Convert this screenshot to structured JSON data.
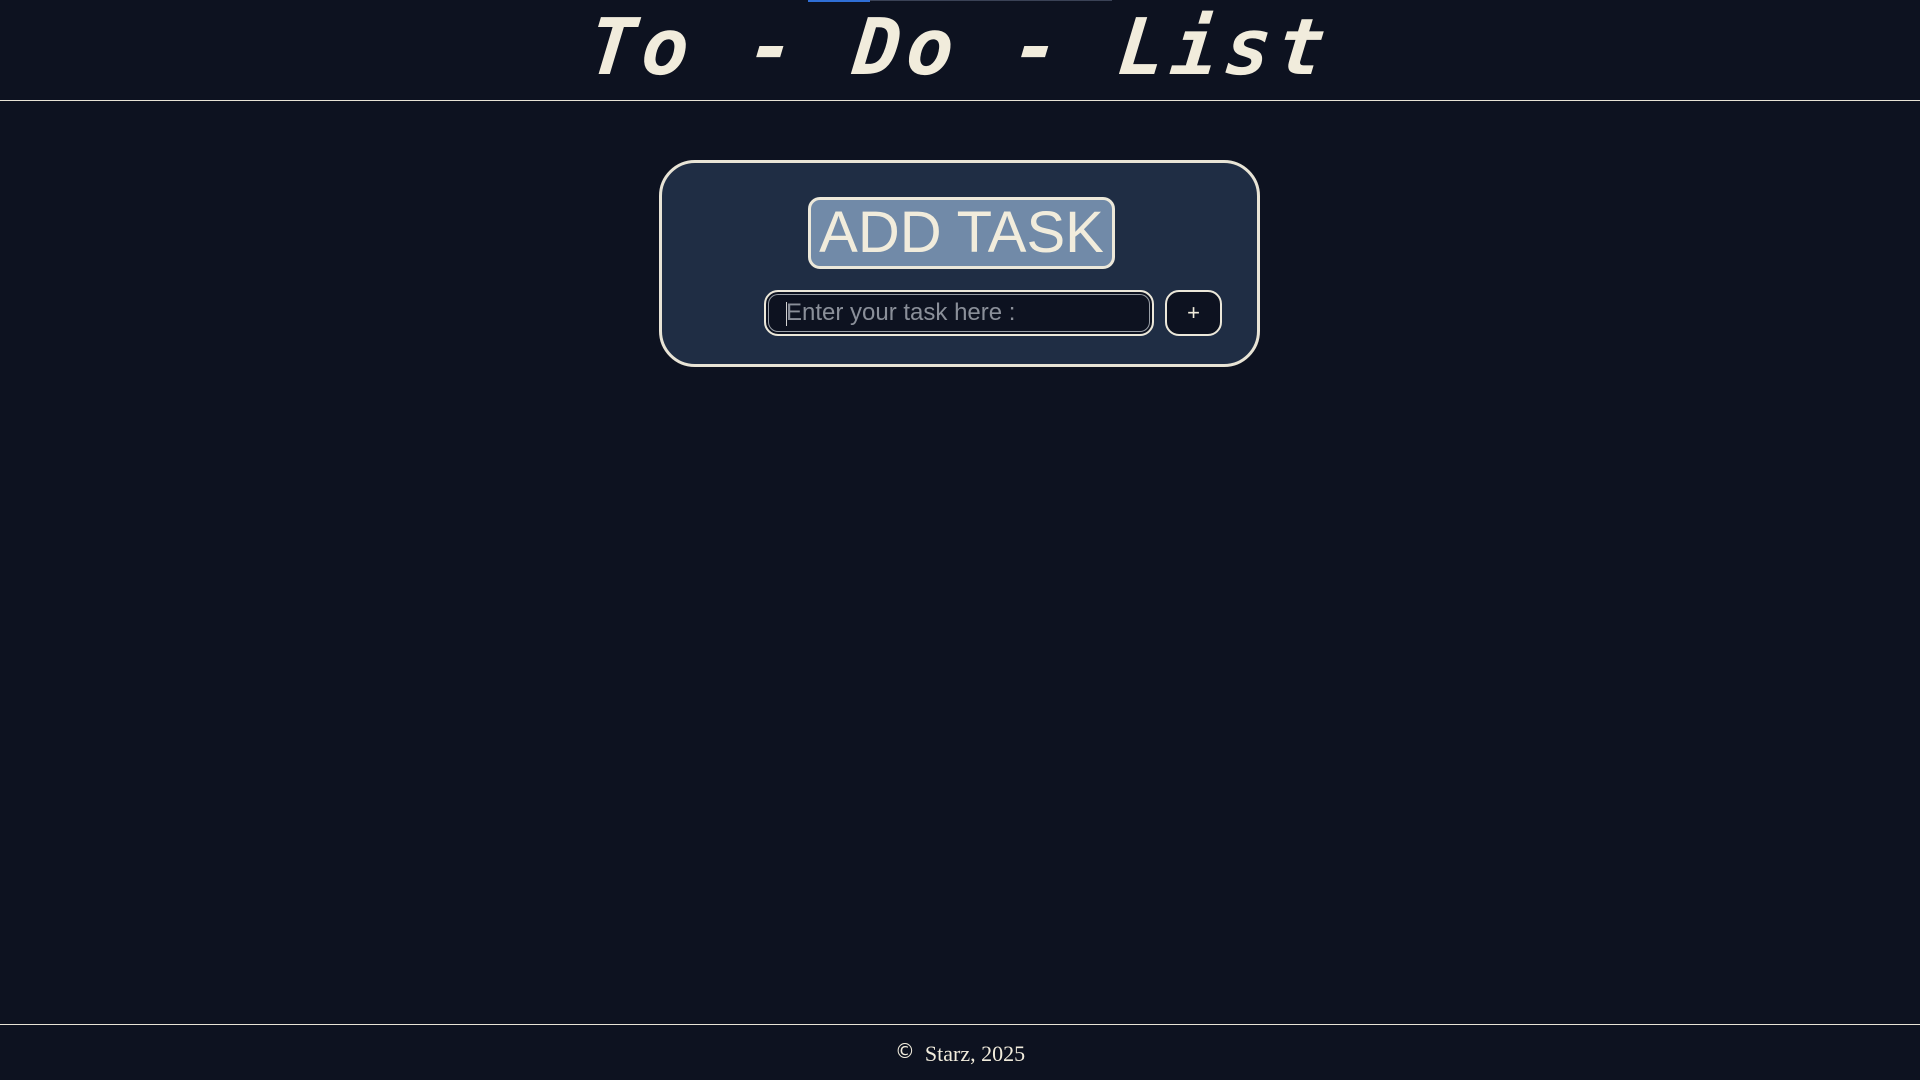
{
  "header": {
    "title": "To - Do - List"
  },
  "card": {
    "heading": "ADD TASK",
    "task_input": {
      "value": "",
      "placeholder": "Enter your task here :"
    },
    "add_button_label": "+"
  },
  "footer": {
    "copyright_symbol": "©",
    "text": "Starz, 2025"
  },
  "colors": {
    "background": "#0d1220",
    "card_background": "#1f2d44",
    "heading_background": "#718aa8",
    "text": "#f1ecdc",
    "border": "#e8e4d6",
    "accent": "#2f6fd6"
  },
  "icons": {
    "copyright": "copyright-icon"
  }
}
